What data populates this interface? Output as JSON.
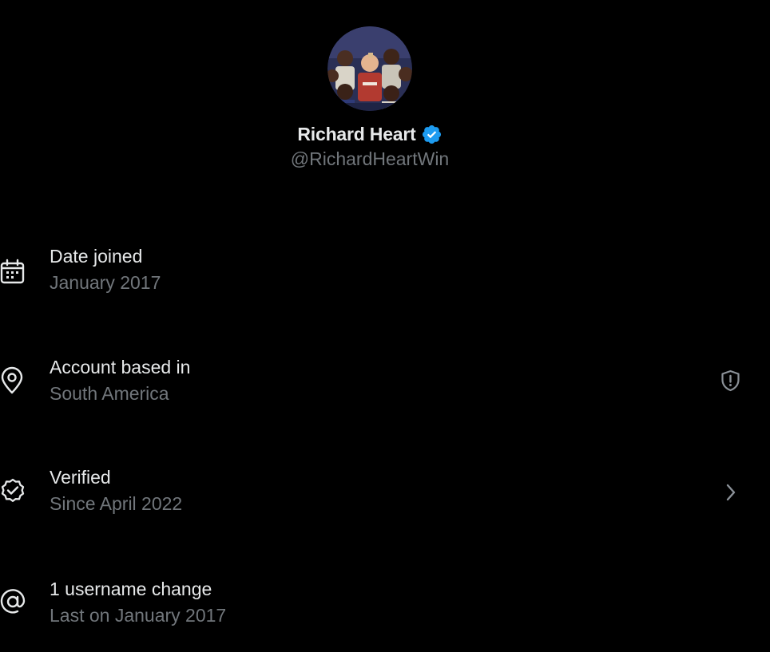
{
  "profile": {
    "display_name": "Richard Heart",
    "handle": "@RichardHeartWin",
    "verified_badge_color": "#1d9bf0",
    "avatar_icon": "profile-photo"
  },
  "rows": [
    {
      "icon": "calendar-icon",
      "title": "Date joined",
      "subtitle": "January 2017"
    },
    {
      "icon": "location-pin-icon",
      "title": "Account based in",
      "subtitle": "South America",
      "trailing_icon": "shield-alert-icon"
    },
    {
      "icon": "verified-check-icon",
      "title": "Verified",
      "subtitle": "Since April 2022",
      "trailing_icon": "chevron-right-icon"
    },
    {
      "icon": "at-sign-icon",
      "title": "1 username change",
      "subtitle": "Last on January 2017"
    }
  ],
  "colors": {
    "background": "#000000",
    "primary_text": "#e7e9ea",
    "secondary_text": "#71767b",
    "accent": "#1d9bf0"
  }
}
